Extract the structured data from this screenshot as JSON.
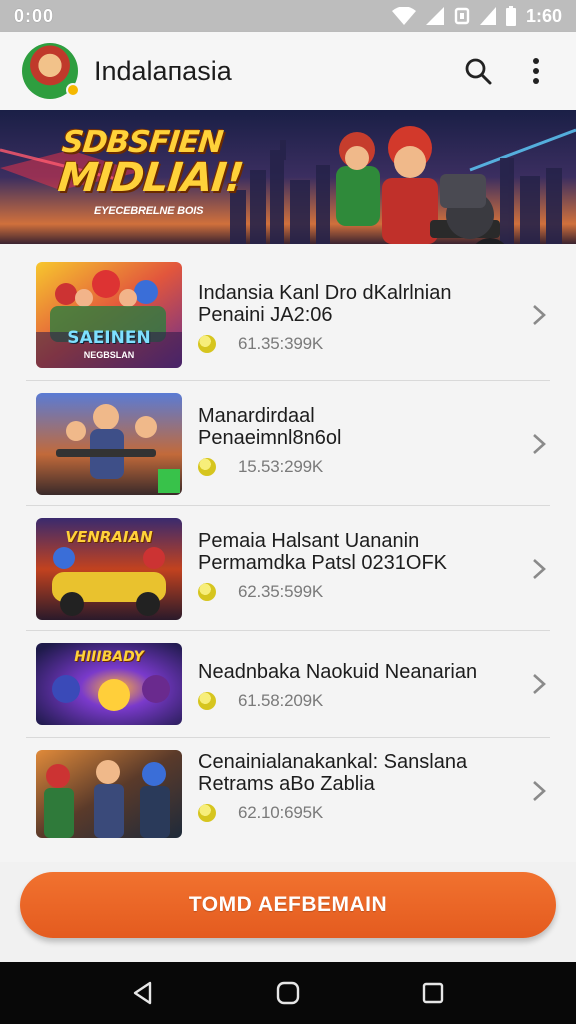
{
  "status_bar": {
    "time_left": "0:00",
    "time_right": "1:60"
  },
  "app": {
    "title": "Indalaпasia",
    "actions": [
      "search-icon",
      "more-vert-icon"
    ]
  },
  "banner": {
    "headline_1": "SDBSFIEN",
    "headline_2": "MIDLIAI!",
    "subtitle": "EYECEBRELNE BOIS"
  },
  "games": [
    {
      "title_lines": [
        "Indansia Kanl Dro dKalrlnian",
        "Penaini JA2:06"
      ],
      "size": "61.35:399K",
      "thumb_label_1": "SAEINEN",
      "thumb_label_2": "NEGBSLAN"
    },
    {
      "title_lines": [
        "Manardirdaal",
        "Penaeimnl8n6ol"
      ],
      "size": "15.53:299K"
    },
    {
      "title_lines": [
        "Pemaia Halsant Uananin",
        "Permamdka Patsl 0231OFK"
      ],
      "size": "62.35:599K",
      "thumb_label_1": "VENRAIAN"
    },
    {
      "title_lines": [
        "Neadnbaka Naokuid Neanarian"
      ],
      "size": "61.58:209K",
      "thumb_label_1": "HIIIBADY"
    },
    {
      "title_lines": [
        "Cenainialanakankal: Sanslana",
        "Retrams aBo Zablia"
      ],
      "size": "62.10:695K"
    }
  ],
  "cta": {
    "label": "TOMD AEFBEMAIN"
  },
  "colors": {
    "accent": "#e8621f",
    "status_bar": "#bdbdbd",
    "nav_bar": "#080808"
  }
}
